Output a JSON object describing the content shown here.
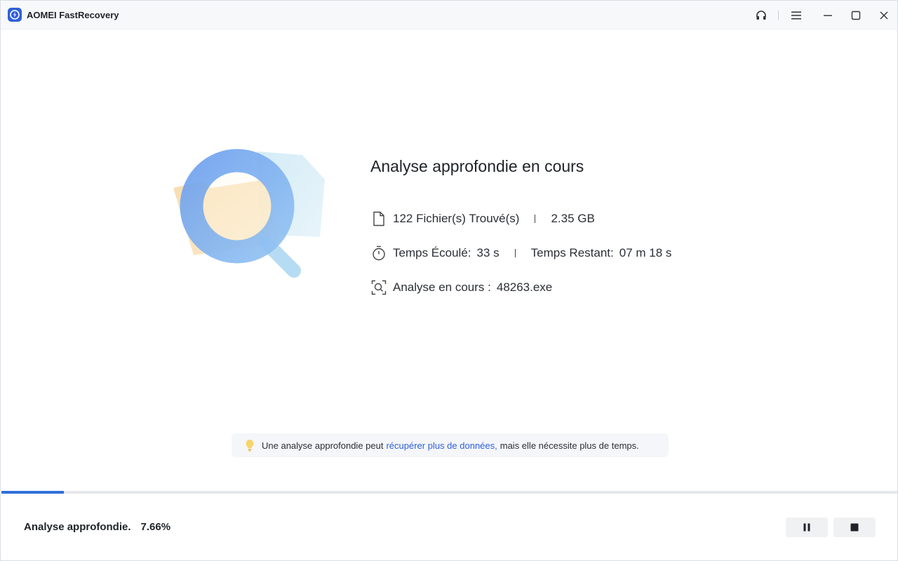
{
  "app": {
    "title": "AOMEI FastRecovery"
  },
  "titlebar": {
    "icons": [
      "support-headset-icon",
      "menu-icon",
      "minimize-icon",
      "maximize-icon",
      "close-icon"
    ]
  },
  "scan": {
    "title": "Analyse approfondie en cours",
    "files_found": "122 Fichier(s) Trouvé(s)",
    "size": "2.35 GB",
    "elapsed_label": "Temps Écoulé:",
    "elapsed_value": "33 s",
    "remaining_label": "Temps Restant:",
    "remaining_value": "07 m 18 s",
    "current_label": "Analyse en cours :",
    "current_file": "48263.exe"
  },
  "tip": {
    "prefix": "Une analyse approfondie peut",
    "link": "récupérer plus de données,",
    "suffix": "mais elle nécessite plus de temps."
  },
  "progress": {
    "label": "Analyse approfondie.",
    "percent_text": "7.66%",
    "fraction": 0.0766
  },
  "colors": {
    "accent": "#2f6fd9",
    "link": "#2f5fd9"
  }
}
